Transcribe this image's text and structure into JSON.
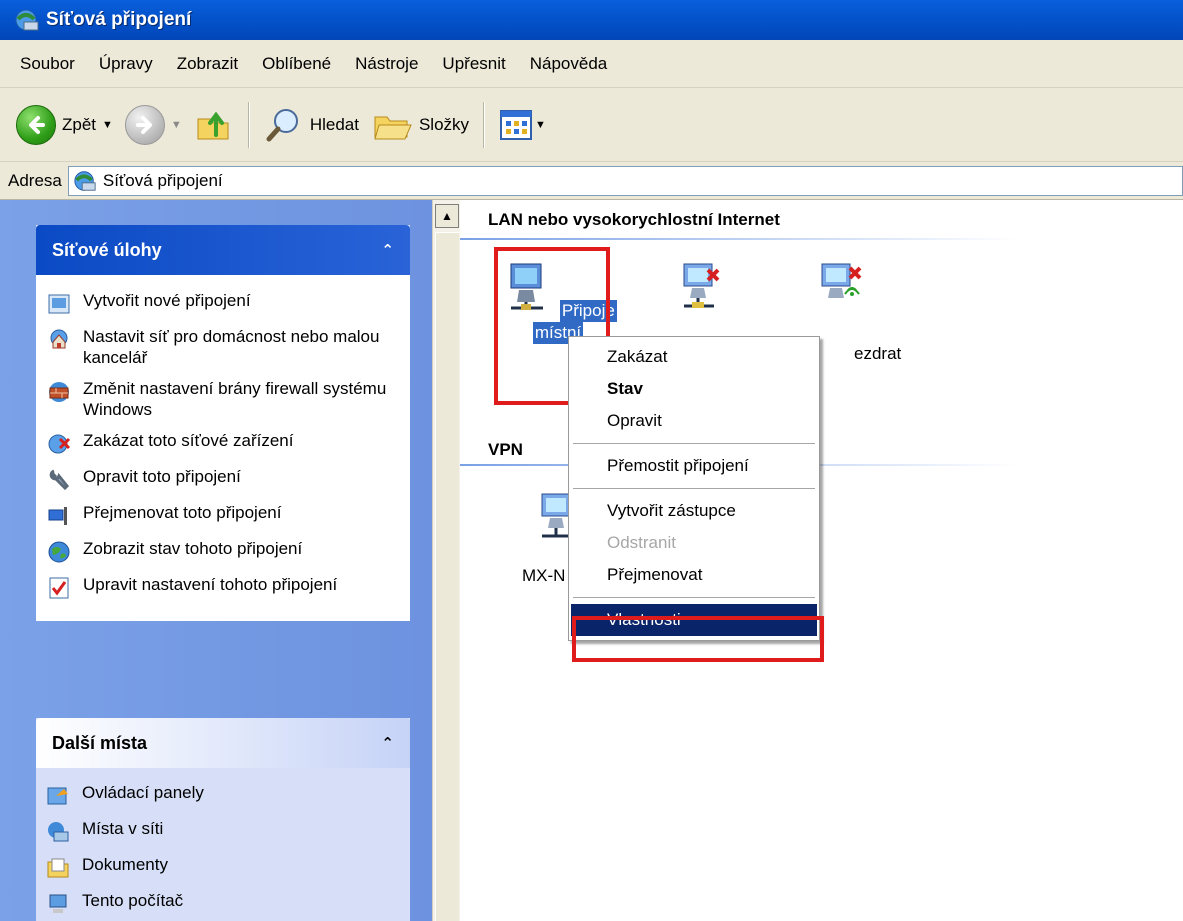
{
  "window": {
    "title": "Síťová připojení"
  },
  "menu": [
    "Soubor",
    "Úpravy",
    "Zobrazit",
    "Oblíbené",
    "Nástroje",
    "Upřesnit",
    "Nápověda"
  ],
  "toolbar": {
    "back_label": "Zpět",
    "search_label": "Hledat",
    "folders_label": "Složky"
  },
  "address": {
    "label": "Adresa",
    "value": "Síťová připojení"
  },
  "tasks_panel": {
    "title": "Síťové úlohy",
    "items": [
      "Vytvořit nové připojení",
      "Nastavit síť pro domácnost nebo malou kancelář",
      "Změnit nastavení brány firewall systému Windows",
      "Zakázat toto síťové zařízení",
      "Opravit toto připojení",
      "Přejmenovat toto připojení",
      "Zobrazit stav tohoto připojení",
      "Upravit nastavení tohoto připojení"
    ]
  },
  "places_panel": {
    "title": "Další místa",
    "items": [
      "Ovládací panely",
      "Místa v síti",
      "Dokumenty",
      "Tento počítač"
    ]
  },
  "groups": {
    "lan_title": "LAN nebo vysokorychlostní Internet",
    "vpn_title": "VPN"
  },
  "connections": {
    "lan_selected_line1": "Připoje",
    "lan_selected_line2": "místní",
    "wireless_partial": "ezdrat",
    "vpn_partial": "MX-N"
  },
  "context_menu": {
    "items": [
      "Zakázat",
      "Stav",
      "Opravit",
      "Přemostit připojení",
      "Vytvořit zástupce",
      "Odstranit",
      "Přejmenovat",
      "Vlastnosti"
    ]
  },
  "colors": {
    "highlight": "#0a246a",
    "annotation_red": "#e01b1b",
    "task_pane_blue": "#6d92df"
  }
}
